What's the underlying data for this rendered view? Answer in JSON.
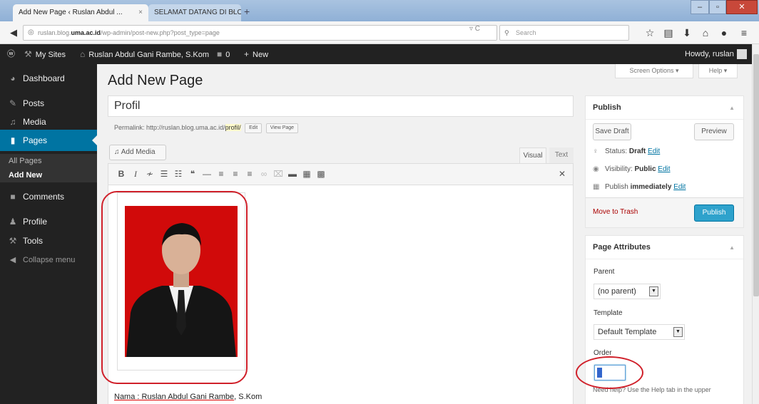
{
  "browser": {
    "tabs": [
      {
        "title": "Add New Page ‹ Ruslan Abdul ...",
        "close": "×"
      },
      {
        "title": "SELAMAT DATANG DI BLOG U...",
        "close": "×"
      }
    ],
    "new_tab": "+",
    "url_host_prefix": "ruslan.blog.",
    "url_host_bold": "uma.ac.id",
    "url_path": "/wp-admin/post-new.php?post_type=page",
    "search_placeholder": "Search"
  },
  "adminbar": {
    "my_sites": "My Sites",
    "site_name": "Ruslan Abdul Gani Rambe, S.Kom",
    "comments_count": "0",
    "new_label": "New",
    "howdy": "Howdy, ruslan"
  },
  "sidebar": {
    "items": [
      {
        "label": "Dashboard",
        "icon": "dashboard-icon"
      },
      {
        "label": "Posts",
        "icon": "pin-icon"
      },
      {
        "label": "Media",
        "icon": "media-icon"
      },
      {
        "label": "Pages",
        "icon": "pages-icon"
      },
      {
        "label": "Comments",
        "icon": "comment-icon"
      },
      {
        "label": "Profile",
        "icon": "user-icon"
      },
      {
        "label": "Tools",
        "icon": "wrench-icon"
      },
      {
        "label": "Collapse menu",
        "icon": "collapse-icon"
      }
    ],
    "pages_submenu": [
      "All Pages",
      "Add New"
    ]
  },
  "main": {
    "title": "Add New Page",
    "screen_options": "Screen Options ▾",
    "help": "Help ▾",
    "post_title": "Profil",
    "permalink_label": "Permalink:",
    "permalink_base": "http://ruslan.blog.uma.ac.id/",
    "permalink_slug": "profil/",
    "edit_btn": "Edit",
    "view_page_btn": "View Page",
    "add_media": "Add Media",
    "tab_visual": "Visual",
    "tab_text": "Text",
    "caption_prefix": "Nama : ",
    "caption_name": "Ruslan Abdul Gani Rambe",
    "caption_suffix": ", S.Kom"
  },
  "publish": {
    "title": "Publish",
    "save_draft": "Save Draft",
    "preview": "Preview",
    "status_label": "Status:",
    "status_value": "Draft",
    "visibility_label": "Visibility:",
    "visibility_value": "Public",
    "publish_label": "Publish",
    "publish_value": "immediately",
    "edit": "Edit",
    "move_to_trash": "Move to Trash",
    "publish_btn": "Publish"
  },
  "page_attributes": {
    "title": "Page Attributes",
    "parent_label": "Parent",
    "parent_value": "(no parent)",
    "template_label": "Template",
    "template_value": "Default Template",
    "order_label": "Order",
    "order_value": "0",
    "help_text": "Need help? Use the Help tab in the upper"
  },
  "colors": {
    "accent": "#0074a2",
    "primary_button": "#2ea2cc",
    "annotation_red": "#d0202a",
    "photo_bg": "#d10a0a"
  }
}
